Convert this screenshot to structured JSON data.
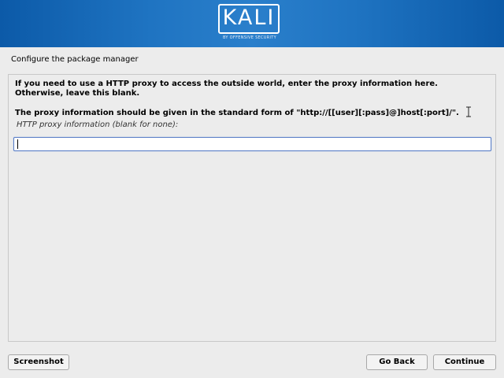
{
  "header": {
    "logo_text": "KALI",
    "logo_subtitle": "BY OFFENSIVE SECURITY"
  },
  "page": {
    "title": "Configure the package manager"
  },
  "content": {
    "paragraph1": "If you need to use a HTTP proxy to access the outside world, enter the proxy information here. Otherwise, leave this blank.",
    "paragraph2": "The proxy information should be given in the standard form of \"http://[[user][:pass]@]host[:port]/\".",
    "field_label": "HTTP proxy information (blank for none):",
    "field_value": ""
  },
  "buttons": {
    "screenshot": "Screenshot",
    "go_back": "Go Back",
    "continue": "Continue"
  },
  "colors": {
    "banner": "#1f74c2",
    "input_border": "#5b7fc7"
  },
  "icons": {
    "cursor": "text-ibeam-cursor-icon"
  }
}
